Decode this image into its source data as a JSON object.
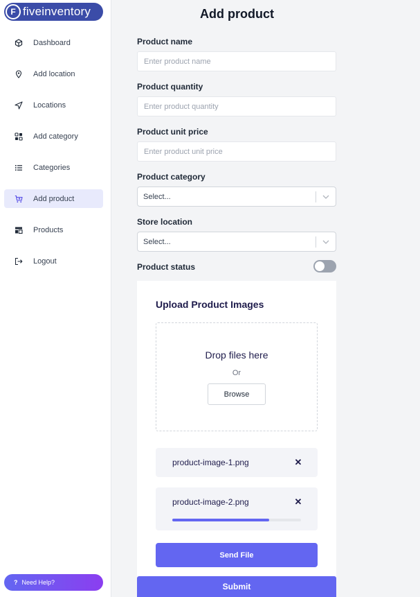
{
  "brand": {
    "mark": "F",
    "name": "fiveinventory"
  },
  "sidebar": {
    "items": [
      {
        "label": "Dashboard",
        "icon": "cube-icon"
      },
      {
        "label": "Add location",
        "icon": "location-pin-icon"
      },
      {
        "label": "Locations",
        "icon": "navigation-arrow-icon"
      },
      {
        "label": "Add category",
        "icon": "grid-icon"
      },
      {
        "label": "Categories",
        "icon": "list-icon"
      },
      {
        "label": "Add product",
        "icon": "cart-plus-icon",
        "active": true
      },
      {
        "label": "Products",
        "icon": "layout-icon"
      },
      {
        "label": "Logout",
        "icon": "logout-icon"
      }
    ],
    "help": {
      "glyph": "?",
      "label": "Need Help?"
    }
  },
  "page": {
    "title": "Add product"
  },
  "form": {
    "product_name": {
      "label": "Product name",
      "placeholder": "Enter product name",
      "value": ""
    },
    "product_quantity": {
      "label": "Product quantity",
      "placeholder": "Enter product quantity",
      "value": ""
    },
    "product_unit_price": {
      "label": "Product unit price",
      "placeholder": "Enter product unit price",
      "value": ""
    },
    "product_category": {
      "label": "Product category",
      "selected": "Select..."
    },
    "store_location": {
      "label": "Store location",
      "selected": "Select..."
    },
    "product_status": {
      "label": "Product status",
      "enabled": false
    }
  },
  "upload": {
    "title": "Upload Product Images",
    "drop_text": "Drop files here",
    "or_text": "Or",
    "browse_label": "Browse",
    "files": [
      {
        "name": "product-image-1.png",
        "remove_glyph": "✕"
      },
      {
        "name": "product-image-2.png",
        "remove_glyph": "✕",
        "progress": 0.75
      }
    ],
    "send_label": "Send File"
  },
  "submit_label": "Submit",
  "colors": {
    "accent": "#6366f1",
    "brand": "#3b4ca8",
    "active_bg": "#e8eafc"
  }
}
